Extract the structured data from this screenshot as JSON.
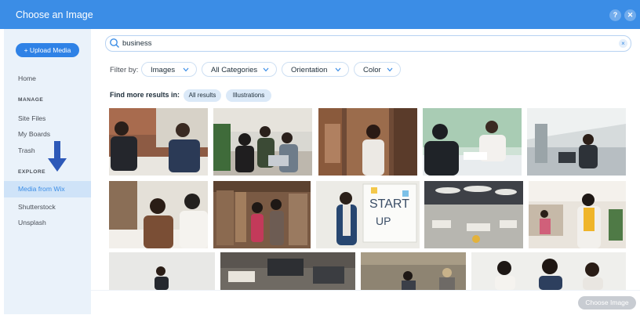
{
  "window": {
    "title": "Choose an Image",
    "help_icon": "question-icon",
    "close_icon": "close-icon",
    "accent_color": "#3b8de6"
  },
  "sidebar": {
    "upload_label": "+ Upload Media",
    "home": "Home",
    "manage_heading": "MANAGE",
    "manage_items": [
      "Site Files",
      "My Boards",
      "Trash"
    ],
    "explore_heading": "EXPLORE",
    "explore_items": [
      "Media from Wix",
      "Shutterstock",
      "Unsplash"
    ],
    "active_item": "Media from Wix"
  },
  "search": {
    "value": "business",
    "icon": "search-icon",
    "clear_icon": "clear-icon"
  },
  "filters": {
    "label": "Filter by:",
    "options": [
      "Images",
      "All Categories",
      "Orientation",
      "Color"
    ]
  },
  "more_results": {
    "label": "Find more results in:",
    "tags": [
      "All results",
      "Illustrations"
    ]
  },
  "footer": {
    "choose_label": "Choose Image"
  }
}
